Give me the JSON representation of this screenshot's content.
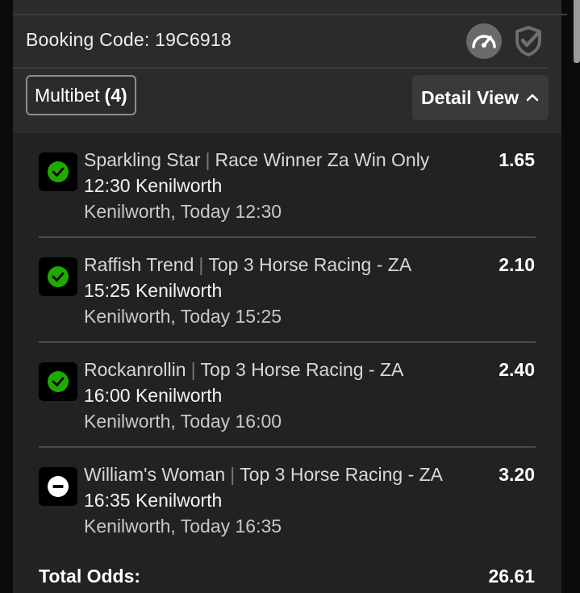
{
  "header": {
    "booking_label": "Booking Code:",
    "booking_code": "19C6918"
  },
  "bet": {
    "type_label": "Multibet",
    "count": "(4)",
    "detail_view_label": "Detail View"
  },
  "legs": [
    {
      "selection": "Sparkling Star",
      "market": "Race Winner Za Win Only",
      "event": "12:30 Kenilworth",
      "venue_time": "Kenilworth, Today 12:30",
      "odds": "1.65",
      "status": "won"
    },
    {
      "selection": "Raffish Trend",
      "market": "Top 3 Horse Racing - ZA",
      "event": "15:25 Kenilworth",
      "venue_time": "Kenilworth, Today 15:25",
      "odds": "2.10",
      "status": "won"
    },
    {
      "selection": "Rockanrollin",
      "market": "Top 3 Horse Racing - ZA",
      "event": "16:00 Kenilworth",
      "venue_time": "Kenilworth, Today 16:00",
      "odds": "2.40",
      "status": "won"
    },
    {
      "selection": "William's Woman",
      "market": "Top 3 Horse Racing - ZA",
      "event": "16:35 Kenilworth",
      "venue_time": "Kenilworth, Today 16:35",
      "odds": "3.20",
      "status": "void"
    }
  ],
  "totals": {
    "label": "Total Odds:",
    "value": "26.61"
  },
  "icons": {
    "speedometer": "speedometer-icon",
    "shield_check": "shield-check-icon",
    "chevron_up": "chevron-up-icon",
    "check": "check-circle-icon",
    "void": "minus-circle-icon"
  },
  "colors": {
    "won": "#1faa00",
    "panel": "#2b2b2b",
    "list_bg": "#222222"
  }
}
